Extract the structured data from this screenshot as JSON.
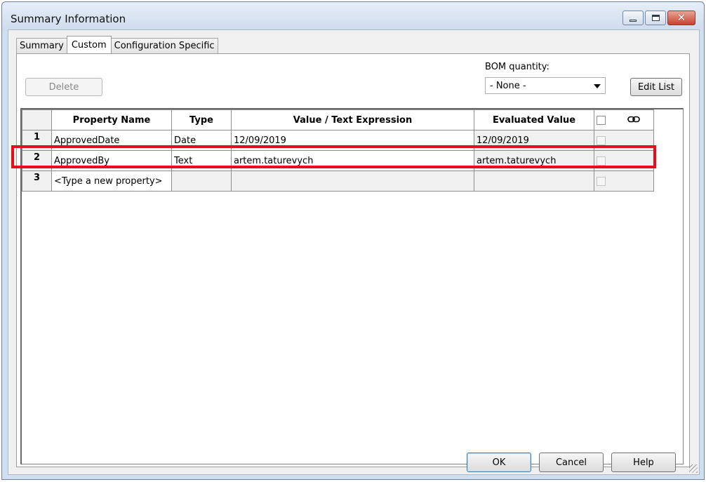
{
  "window": {
    "title": "Summary Information",
    "close_glyph": "✕"
  },
  "tabs": [
    {
      "label": "Summary",
      "active": false
    },
    {
      "label": "Custom",
      "active": true
    },
    {
      "label": "Configuration Specific",
      "active": false
    }
  ],
  "toolbar": {
    "delete_label": "Delete",
    "bom_label": "BOM quantity:",
    "bom_value": "- None -",
    "edit_list_label": "Edit List"
  },
  "grid": {
    "headers": [
      "Property Name",
      "Type",
      "Value / Text Expression",
      "Evaluated Value"
    ],
    "rows": [
      {
        "num": "1",
        "name": "ApprovedDate",
        "type": "Date",
        "value": "12/09/2019",
        "evaluated": "12/09/2019",
        "linked": false
      },
      {
        "num": "2",
        "name": "ApprovedBy",
        "type": "Text",
        "value": "artem.taturevych",
        "evaluated": "artem.taturevych",
        "linked": false
      },
      {
        "num": "3",
        "name": "<Type a new property>",
        "type": "",
        "value": "",
        "evaluated": "",
        "linked": false
      }
    ],
    "highlighted_row": "2",
    "highlight_color": "#e3101b"
  },
  "footer": {
    "ok_label": "OK",
    "cancel_label": "Cancel",
    "help_label": "Help"
  }
}
